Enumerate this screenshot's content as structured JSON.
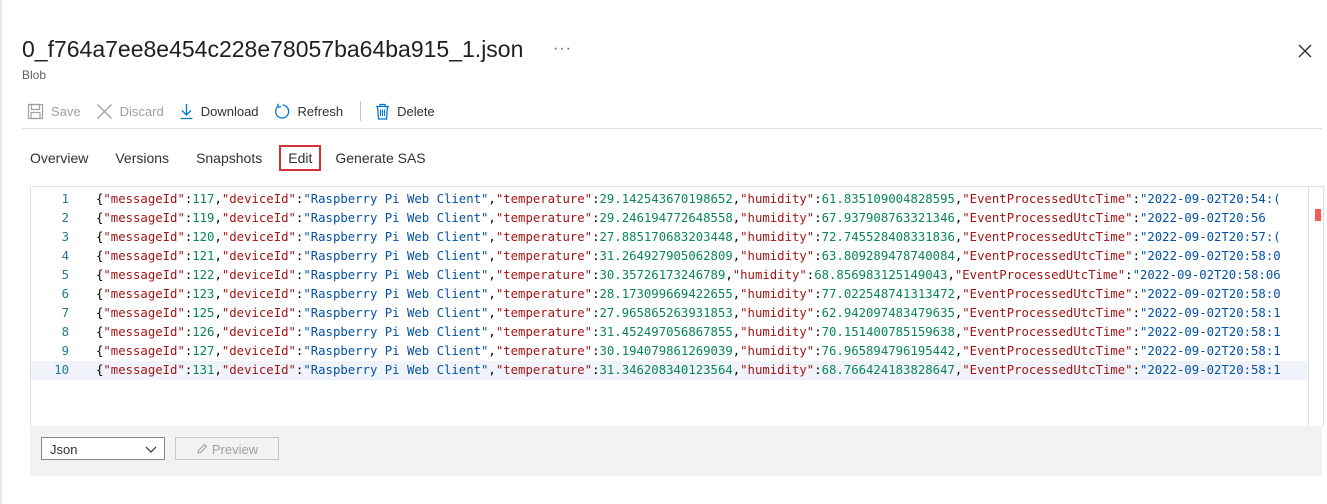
{
  "header": {
    "title": "0_f764a7ee8e454c228e78057ba64ba915_1.json",
    "more": "···",
    "subtitle": "Blob"
  },
  "toolbar": {
    "save": "Save",
    "discard": "Discard",
    "download": "Download",
    "refresh": "Refresh",
    "delete": "Delete"
  },
  "tabs": [
    "Overview",
    "Versions",
    "Snapshots",
    "Edit",
    "Generate SAS"
  ],
  "active_tab": "Edit",
  "editor": {
    "lines": [
      {
        "num": "1",
        "messageId": "117",
        "deviceId": "Raspberry Pi Web Client",
        "temperature": "29.142543670198652",
        "humidity": "61.835109004828595",
        "time": "2022-09-02T20:54:("
      },
      {
        "num": "2",
        "messageId": "119",
        "deviceId": "Raspberry Pi Web Client",
        "temperature": "29.246194772648558",
        "humidity": "67.937908763321346",
        "time": "2022-09-02T20:56"
      },
      {
        "num": "3",
        "messageId": "120",
        "deviceId": "Raspberry Pi Web Client",
        "temperature": "27.885170683203448",
        "humidity": "72.745528408331836",
        "time": "2022-09-02T20:57:("
      },
      {
        "num": "4",
        "messageId": "121",
        "deviceId": "Raspberry Pi Web Client",
        "temperature": "31.264927905062809",
        "humidity": "63.809289478740084",
        "time": "2022-09-02T20:58:0"
      },
      {
        "num": "5",
        "messageId": "122",
        "deviceId": "Raspberry Pi Web Client",
        "temperature": "30.35726173246789",
        "humidity": "68.856983125149043",
        "time": "2022-09-02T20:58:06"
      },
      {
        "num": "6",
        "messageId": "123",
        "deviceId": "Raspberry Pi Web Client",
        "temperature": "28.173099669422655",
        "humidity": "77.022548741313472",
        "time": "2022-09-02T20:58:0"
      },
      {
        "num": "7",
        "messageId": "125",
        "deviceId": "Raspberry Pi Web Client",
        "temperature": "27.965865263931853",
        "humidity": "62.942097483479635",
        "time": "2022-09-02T20:58:1"
      },
      {
        "num": "8",
        "messageId": "126",
        "deviceId": "Raspberry Pi Web Client",
        "temperature": "31.452497056867855",
        "humidity": "70.151400785159638",
        "time": "2022-09-02T20:58:1"
      },
      {
        "num": "9",
        "messageId": "127",
        "deviceId": "Raspberry Pi Web Client",
        "temperature": "30.194079861269039",
        "humidity": "76.965894796195442",
        "time": "2022-09-02T20:58:1"
      },
      {
        "num": "10",
        "messageId": "131",
        "deviceId": "Raspberry Pi Web Client",
        "temperature": "31.346208340123564",
        "humidity": "68.766424183828647",
        "time": "2022-09-02T20:58:1"
      }
    ],
    "keys": {
      "messageId": "\"messageId\"",
      "deviceId": "\"deviceId\"",
      "temperature": "\"temperature\"",
      "humidity": "\"humidity\"",
      "time": "\"EventProcessedUtcTime\""
    }
  },
  "footer": {
    "format": "Json",
    "preview": "Preview"
  },
  "colors": {
    "accent": "#0078d4",
    "active_tab_outline": "#d13438",
    "json_key": "#a31515",
    "json_string": "#0451a5",
    "json_number": "#098658"
  }
}
